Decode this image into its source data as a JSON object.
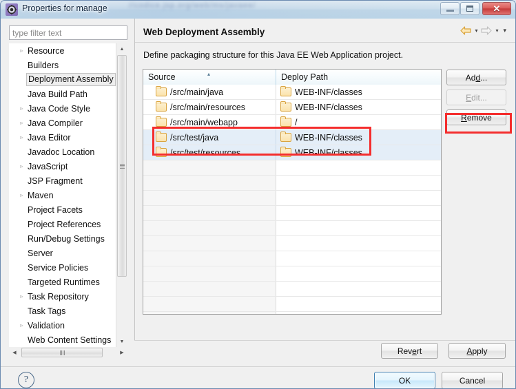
{
  "window": {
    "title": "Properties for manage",
    "icon": "gear-icon",
    "glass_text_1": "//codice.jsp.org/web/ms/javaee/",
    "glass_text_2": "",
    "controls": {
      "minimize": "–",
      "maximize": "□",
      "close": "✕"
    }
  },
  "sidebar": {
    "filter": {
      "placeholder": "type filter text",
      "value": ""
    },
    "items": [
      {
        "label": "Resource",
        "expandable": true,
        "selected": false
      },
      {
        "label": "Builders",
        "expandable": false,
        "selected": false
      },
      {
        "label": "Deployment Assembly",
        "expandable": false,
        "selected": true
      },
      {
        "label": "Java Build Path",
        "expandable": false,
        "selected": false
      },
      {
        "label": "Java Code Style",
        "expandable": true,
        "selected": false
      },
      {
        "label": "Java Compiler",
        "expandable": true,
        "selected": false
      },
      {
        "label": "Java Editor",
        "expandable": true,
        "selected": false
      },
      {
        "label": "Javadoc Location",
        "expandable": false,
        "selected": false
      },
      {
        "label": "JavaScript",
        "expandable": true,
        "selected": false
      },
      {
        "label": "JSP Fragment",
        "expandable": false,
        "selected": false
      },
      {
        "label": "Maven",
        "expandable": true,
        "selected": false
      },
      {
        "label": "Project Facets",
        "expandable": false,
        "selected": false
      },
      {
        "label": "Project References",
        "expandable": false,
        "selected": false
      },
      {
        "label": "Run/Debug Settings",
        "expandable": false,
        "selected": false
      },
      {
        "label": "Server",
        "expandable": false,
        "selected": false
      },
      {
        "label": "Service Policies",
        "expandable": false,
        "selected": false
      },
      {
        "label": "Targeted Runtimes",
        "expandable": false,
        "selected": false
      },
      {
        "label": "Task Repository",
        "expandable": true,
        "selected": false
      },
      {
        "label": "Task Tags",
        "expandable": false,
        "selected": false
      },
      {
        "label": "Validation",
        "expandable": true,
        "selected": false
      },
      {
        "label": "Web Content Settings",
        "expandable": false,
        "selected": false
      }
    ],
    "expand_arrow": "▹",
    "scrollbar": {
      "up_arrow": "▲",
      "down_arrow": "▼",
      "left_arrow": "◀",
      "right_arrow": "▶"
    }
  },
  "content": {
    "title": "Web Deployment Assembly",
    "description": "Define packaging structure for this Java EE Web Application project.",
    "nav": {
      "back_arrow": "⇦",
      "back_enabled": true,
      "forward_arrow": "⇨",
      "forward_enabled": false,
      "chevron": "▾"
    },
    "table": {
      "columns": [
        "Source",
        "Deploy Path"
      ],
      "sort_indicator": "▴",
      "sorted_column": "Source",
      "rows": [
        {
          "source": "/src/main/java",
          "deploy": "WEB-INF/classes",
          "selected": false
        },
        {
          "source": "/src/main/resources",
          "deploy": "WEB-INF/classes",
          "selected": false
        },
        {
          "source": "/src/main/webapp",
          "deploy": "/",
          "selected": false
        },
        {
          "source": "/src/test/java",
          "deploy": "WEB-INF/classes",
          "selected": true
        },
        {
          "source": "/src/test/resources",
          "deploy": "WEB-INF/classes",
          "selected": true
        }
      ],
      "empty_row_count": 11
    },
    "side_buttons": [
      {
        "label": "Add...",
        "mnemonic_index": 2,
        "enabled": true,
        "highlighted": false
      },
      {
        "label": "Edit...",
        "mnemonic_index": 0,
        "enabled": false,
        "highlighted": false
      },
      {
        "label": "Remove",
        "mnemonic_index": 0,
        "enabled": true,
        "highlighted": true
      }
    ],
    "apply_buttons": [
      {
        "label": "Revert",
        "mnemonic_index": 3
      },
      {
        "label": "Apply",
        "mnemonic_index": 0
      }
    ]
  },
  "footer": {
    "help_icon": "?",
    "ok_label": "OK",
    "cancel_label": "Cancel"
  },
  "colors": {
    "annotation_red": "#f42d2d",
    "selection_blue": "#e4eef8",
    "title_glass": "#b4cde0",
    "default_button_border": "#3c7fb1",
    "folder_gold": "#fbe3ab"
  }
}
